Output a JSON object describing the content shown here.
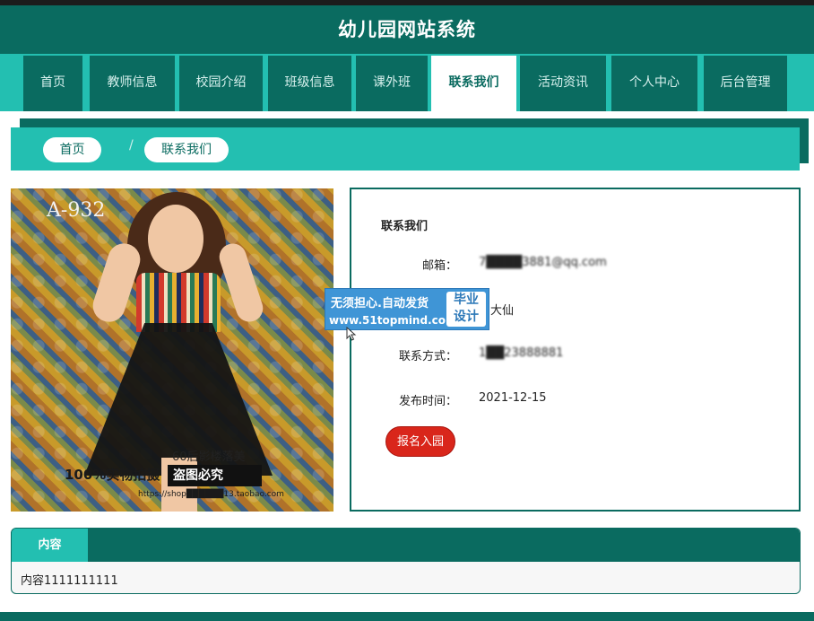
{
  "header": {
    "title": "幼儿园网站系统"
  },
  "nav": {
    "items": [
      {
        "label": "首页"
      },
      {
        "label": "教师信息"
      },
      {
        "label": "校园介绍"
      },
      {
        "label": "班级信息"
      },
      {
        "label": "课外班"
      },
      {
        "label": "联系我们"
      },
      {
        "label": "活动资讯"
      },
      {
        "label": "个人中心"
      },
      {
        "label": "后台管理"
      }
    ],
    "active": "联系我们"
  },
  "breadcrumb": {
    "home": "首页",
    "separator": "/",
    "current": "联系我们"
  },
  "photo": {
    "code_text": "A-932",
    "watermark_a": "60后影楼落美",
    "watermark_b": "100%实物拍摄",
    "watermark_c": "盗图必究",
    "watermark_url": "https://shop██████13.taobao.com"
  },
  "contact": {
    "title": "联系我们",
    "email_label": "邮箱：",
    "email_value": "7████3881@qq.com",
    "name_value": "大仙",
    "phone_label": "联系方式：",
    "phone_value": "1██23888881",
    "date_label": "发布时间：",
    "date_value": "2021-12-15",
    "enroll_button": "报名入园"
  },
  "ad": {
    "line1": "无须担心.自动发货",
    "line2": "www.51topmind.com",
    "box_top": "毕业",
    "box_bottom": "设计"
  },
  "content": {
    "tab": "内容",
    "text": "内容1111111111"
  },
  "colors": {
    "dark": "#0a6b60",
    "teal": "#23bfb1",
    "button": "#d9261b"
  }
}
